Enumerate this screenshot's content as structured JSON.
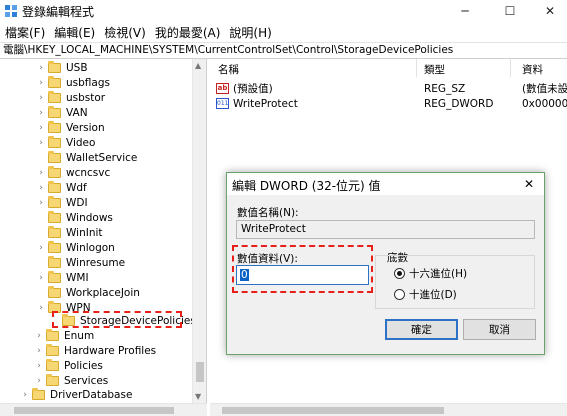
{
  "window": {
    "title": "登錄編輯程式",
    "min_glyph": "─",
    "max_glyph": "☐",
    "close_glyph": "✕",
    "app_icon": "registry-icon"
  },
  "menu": [
    {
      "label": "檔案(F)"
    },
    {
      "label": "編輯(E)"
    },
    {
      "label": "檢視(V)"
    },
    {
      "label": "我的最愛(A)"
    },
    {
      "label": "說明(H)"
    }
  ],
  "address": "電腦\\HKEY_LOCAL_MACHINE\\SYSTEM\\CurrentControlSet\\Control\\StorageDevicePolicies",
  "tree": [
    {
      "label": "USB",
      "expandable": true
    },
    {
      "label": "usbflags",
      "expandable": true
    },
    {
      "label": "usbstor",
      "expandable": true
    },
    {
      "label": "VAN",
      "expandable": true
    },
    {
      "label": "Version",
      "expandable": true
    },
    {
      "label": "Video",
      "expandable": true
    },
    {
      "label": "WalletService",
      "expandable": false
    },
    {
      "label": "wcncsvc",
      "expandable": true
    },
    {
      "label": "Wdf",
      "expandable": true
    },
    {
      "label": "WDI",
      "expandable": true
    },
    {
      "label": "Windows",
      "expandable": false
    },
    {
      "label": "WinInit",
      "expandable": false
    },
    {
      "label": "Winlogon",
      "expandable": true
    },
    {
      "label": "Winresume",
      "expandable": false
    },
    {
      "label": "WMI",
      "expandable": true
    },
    {
      "label": "WorkplaceJoin",
      "expandable": false
    },
    {
      "label": "WPN",
      "expandable": true
    },
    {
      "label": "StorageDevicePolicies",
      "expandable": false,
      "selected": true
    },
    {
      "label": "Enum",
      "expandable": true
    },
    {
      "label": "Hardware Profiles",
      "expandable": true
    },
    {
      "label": "Policies",
      "expandable": true
    },
    {
      "label": "Services",
      "expandable": true
    },
    {
      "label": "DriverDatabase",
      "expandable": true
    }
  ],
  "values_list": {
    "columns": {
      "name": "名稱",
      "type": "類型",
      "data": "資料"
    },
    "rows": [
      {
        "icon": "string-value-icon",
        "icon_text": "ab",
        "name": "(預設值)",
        "type": "REG_SZ",
        "data": "(數值未設"
      },
      {
        "icon": "binary-value-icon",
        "icon_text": "011",
        "name": "WriteProtect",
        "type": "REG_DWORD",
        "data": "0x000000"
      }
    ]
  },
  "dialog": {
    "title": "編輯 DWORD (32-位元) 值",
    "close_glyph": "✕",
    "value_name_label": "數值名稱(N):",
    "value_name": "WriteProtect",
    "value_data_label": "數值資料(V):",
    "value_data": "0",
    "base_label": "底數",
    "base_options": [
      {
        "label": "十六進位(H)",
        "checked": true
      },
      {
        "label": "十進位(D)",
        "checked": false
      }
    ],
    "ok_label": "確定",
    "cancel_label": "取消"
  },
  "colors": {
    "highlight_dashed": "#e8201a",
    "dialog_border": "#6aa36a",
    "selection": "#0a63c8",
    "folder": "#f7d774"
  }
}
